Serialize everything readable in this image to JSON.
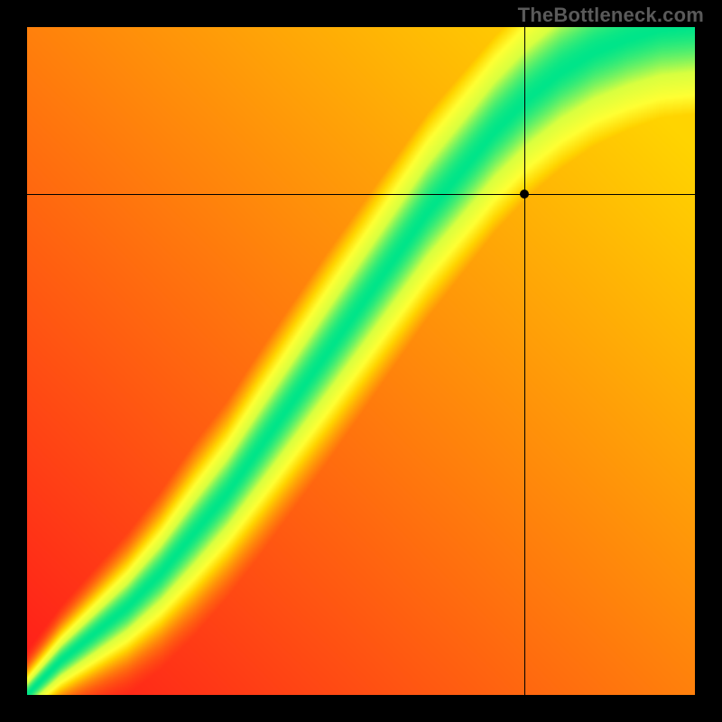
{
  "watermark": "TheBottleneck.com",
  "chart_data": {
    "type": "heatmap",
    "title": "",
    "xlabel": "",
    "ylabel": "",
    "x_range": [
      0,
      1
    ],
    "y_range": [
      0,
      1
    ],
    "crosshair": {
      "x": 0.745,
      "y": 0.75
    },
    "grid": false,
    "description": "Diagonal green efficiency band through yellow transitional zone on a red-to-yellow gradient, indicating optimal pairing along the curved diagonal. Crosshair marks a point near upper-right where the band edge meets yellow.",
    "colormap": [
      {
        "stop": 0.0,
        "color": "#ff1a1a"
      },
      {
        "stop": 0.45,
        "color": "#ffd400"
      },
      {
        "stop": 0.6,
        "color": "#ffff33"
      },
      {
        "stop": 0.78,
        "color": "#d8ff40"
      },
      {
        "stop": 1.0,
        "color": "#00e589"
      }
    ],
    "ridge_samples": [
      {
        "x": 0.0,
        "y": 0.0,
        "width": 0.01
      },
      {
        "x": 0.05,
        "y": 0.05,
        "width": 0.015
      },
      {
        "x": 0.1,
        "y": 0.09,
        "width": 0.02
      },
      {
        "x": 0.15,
        "y": 0.13,
        "width": 0.025
      },
      {
        "x": 0.2,
        "y": 0.18,
        "width": 0.03
      },
      {
        "x": 0.25,
        "y": 0.24,
        "width": 0.035
      },
      {
        "x": 0.3,
        "y": 0.3,
        "width": 0.038
      },
      {
        "x": 0.35,
        "y": 0.37,
        "width": 0.042
      },
      {
        "x": 0.4,
        "y": 0.44,
        "width": 0.045
      },
      {
        "x": 0.45,
        "y": 0.51,
        "width": 0.048
      },
      {
        "x": 0.5,
        "y": 0.58,
        "width": 0.05
      },
      {
        "x": 0.55,
        "y": 0.65,
        "width": 0.052
      },
      {
        "x": 0.6,
        "y": 0.72,
        "width": 0.054
      },
      {
        "x": 0.65,
        "y": 0.78,
        "width": 0.055
      },
      {
        "x": 0.7,
        "y": 0.84,
        "width": 0.056
      },
      {
        "x": 0.75,
        "y": 0.89,
        "width": 0.057
      },
      {
        "x": 0.8,
        "y": 0.93,
        "width": 0.058
      },
      {
        "x": 0.85,
        "y": 0.96,
        "width": 0.058
      },
      {
        "x": 0.9,
        "y": 0.98,
        "width": 0.058
      },
      {
        "x": 0.95,
        "y": 0.995,
        "width": 0.058
      },
      {
        "x": 1.0,
        "y": 1.0,
        "width": 0.058
      }
    ]
  }
}
